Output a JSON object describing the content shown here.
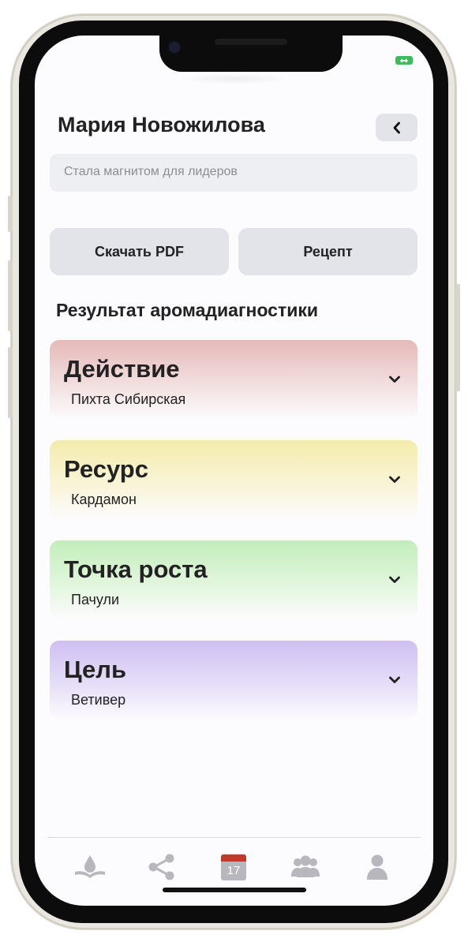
{
  "header": {
    "title": "Мария Новожилова",
    "back_icon": "chevron-left-icon",
    "subtitle_placeholder": "Стала магнитом для лидеров"
  },
  "actions": {
    "download_pdf": "Скачать PDF",
    "recipe": "Рецепт"
  },
  "section_title": "Результат аромадиагностики",
  "cards": [
    {
      "title": "Действие",
      "subtitle": "Пихта Сибирская",
      "color": "#e6b9b9"
    },
    {
      "title": "Ресурс",
      "subtitle": "Кардамон",
      "color": "#f4ecac"
    },
    {
      "title": "Точка роста",
      "subtitle": "Пачули",
      "color": "#c3edbb"
    },
    {
      "title": "Цель",
      "subtitle": "Ветивер",
      "color": "#cfbff1"
    }
  ],
  "tabbar": {
    "items": [
      {
        "icon": "drop-book-icon"
      },
      {
        "icon": "share-icon"
      },
      {
        "icon": "calendar-icon",
        "label": "17",
        "active": true
      },
      {
        "icon": "group-icon"
      },
      {
        "icon": "profile-icon"
      }
    ],
    "icon_color": "#b7b7bd",
    "active_color": "#c0392b"
  },
  "status": {
    "battery_icon": "battery-charging-icon",
    "battery_color": "#3dbb5a"
  }
}
